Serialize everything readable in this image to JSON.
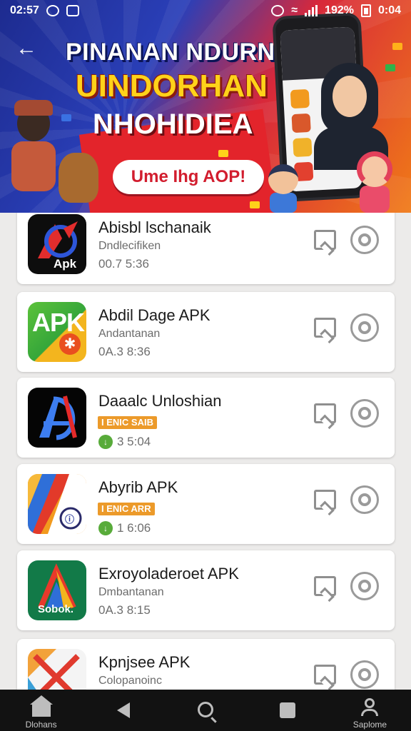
{
  "status_bar": {
    "time_left": "02:57",
    "battery_percent": "192%",
    "time_right": "0:04"
  },
  "banner": {
    "line1": "PINANAN NDURNI",
    "line2": "UINDORHAN",
    "line3": "NHOHIDIEA",
    "cta": "Ume Ihg AOP!"
  },
  "apps": [
    {
      "name": "Abisbl lschanaik",
      "subtitle": "Dndlecifiken",
      "meta": "00.7 5:36",
      "badge": "",
      "icon_text": "Apk",
      "icon": "apk-icon-red-a"
    },
    {
      "name": "Abdil Dage APK",
      "subtitle": "Andantanan",
      "meta": "0A.3 8:36",
      "badge": "",
      "icon_text": "APK",
      "icon": "apk-icon-green"
    },
    {
      "name": "Daaalc Unloshian",
      "subtitle": "",
      "meta": "3 5:04",
      "badge": "I ENIC SAIB",
      "icon_text": "",
      "icon": "apk-icon-dark-a"
    },
    {
      "name": "Abyrib APK",
      "subtitle": "",
      "meta": "1 6:06",
      "badge": "I ENIC ARR",
      "icon_text": "",
      "icon": "apk-icon-stripes"
    },
    {
      "name": "Exroyoladeroet APK",
      "subtitle": "Dmbantanan",
      "meta": "0A.3 8:15",
      "badge": "",
      "icon_text": "Sobok.",
      "icon": "apk-icon-green-a"
    },
    {
      "name": "Kpnjsee APK",
      "subtitle": "Colopanoinc",
      "meta": "",
      "badge": "",
      "icon_text": "",
      "icon": "apk-icon-x"
    }
  ],
  "bottom_nav": [
    {
      "label": "Dlohans",
      "icon": "home-icon"
    },
    {
      "label": "",
      "icon": "back-icon"
    },
    {
      "label": "",
      "icon": "search-icon"
    },
    {
      "label": "",
      "icon": "square-icon"
    },
    {
      "label": "Saplome",
      "icon": "profile-icon"
    }
  ]
}
